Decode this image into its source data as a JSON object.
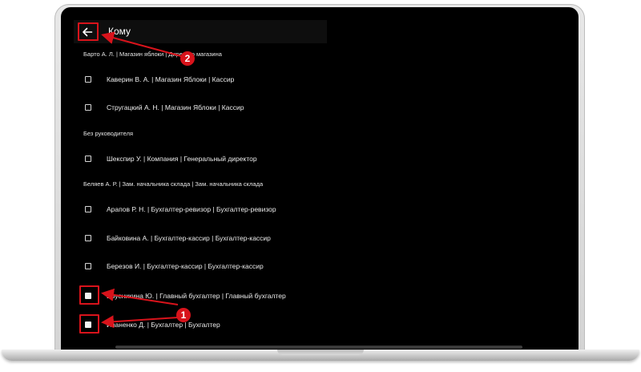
{
  "header": {
    "title": "Кому",
    "back_icon": "arrow-left-icon"
  },
  "groups": [
    {
      "label": "Барто А. Л. | Магазин яблоки | Директор магазина",
      "items": [
        {
          "label": "Каверин В. А. | Магазин Яблоки | Кассир"
        },
        {
          "label": "Стругацкий А. Н. | Магазин Яблоки | Кассир"
        }
      ]
    },
    {
      "label": "Без руководителя",
      "items": [
        {
          "label": "Шекспир У. | Компания | Генеральный директор"
        }
      ]
    },
    {
      "label": "Беляев А. Р. | Зам. начальника склада | Зам. начальника склада",
      "items": [
        {
          "label": "Арапов Р. Н. | Бухгалтер-ревизор | Бухгалтер-ревизор"
        },
        {
          "label": "Байковина А. | Бухгалтер-кассир | Бухгалтер-кассир"
        },
        {
          "label": "Березов И. | Бухгалтер-кассир | Бухгалтер-кассир"
        },
        {
          "label": "Брусникина Ю. | Главный бухгалтер | Главный бухгалтер"
        },
        {
          "label": "Иваненко Д. | Бухгалтер | Бухгалтер"
        }
      ]
    }
  ],
  "annotations": {
    "badge_1": "1",
    "badge_2": "2",
    "color": "#d8131b"
  }
}
